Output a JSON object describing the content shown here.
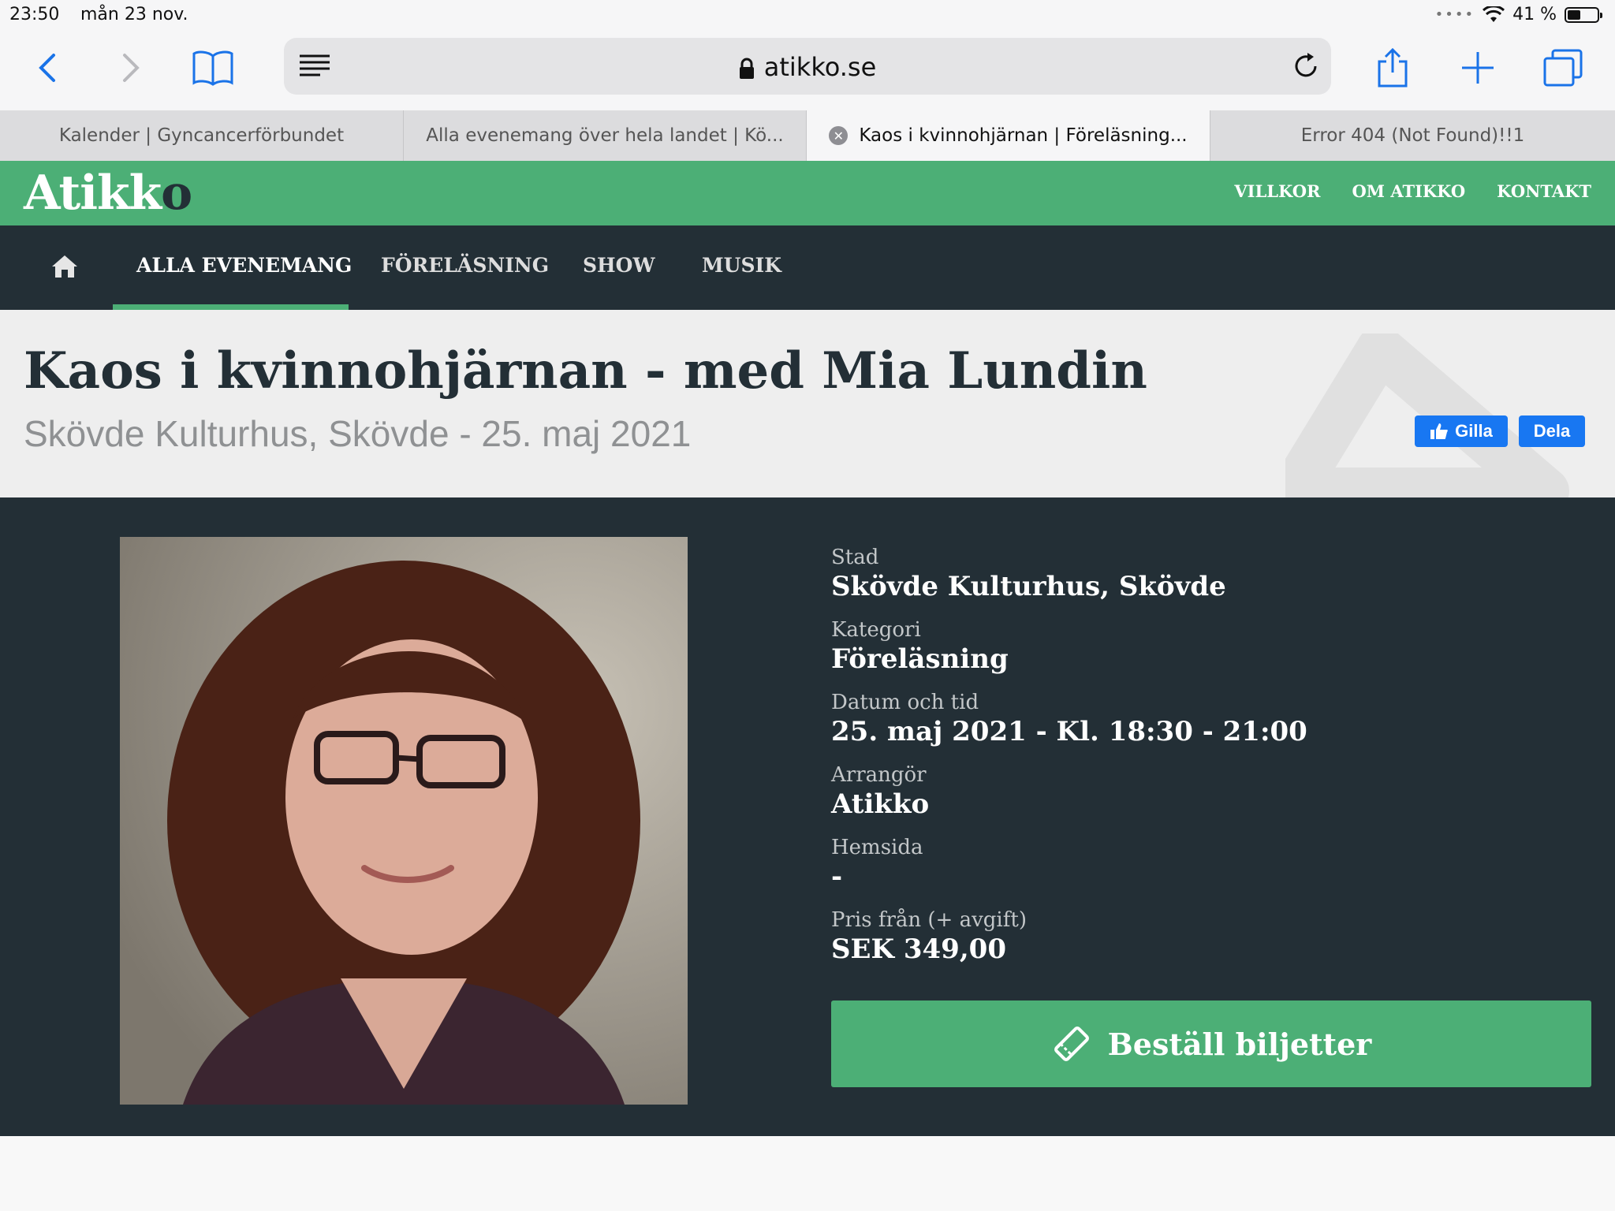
{
  "status_bar": {
    "time": "23:50",
    "date": "mån 23 nov.",
    "battery": "41 %"
  },
  "browser": {
    "url": "atikko.se",
    "tabs": [
      {
        "label": "Kalender | Gyncancerförbundet",
        "active": false
      },
      {
        "label": "Alla evenemang över hela landet | Kö...",
        "active": false
      },
      {
        "label": "Kaos i kvinnohjärnan | Föreläsning...",
        "active": true
      },
      {
        "label": "Error 404 (Not Found)!!1",
        "active": false
      }
    ]
  },
  "site": {
    "logo": "Atikk",
    "logo_last": "o",
    "top_links": [
      "VILLKOR",
      "OM ATIKKO",
      "KONTAKT"
    ],
    "nav": [
      "ALLA EVENEMANG",
      "FÖRELÄSNING",
      "SHOW",
      "MUSIK"
    ],
    "brand_color": "#4caf76",
    "dark_color": "#232f36"
  },
  "event": {
    "title": "Kaos i kvinnohjärnan - med Mia Lundin",
    "subtitle": "Skövde Kulturhus, Skövde - 25. maj 2021",
    "like_label": "Gilla",
    "share_label": "Dela",
    "fields": [
      {
        "label": "Stad",
        "value": "Skövde Kulturhus, Skövde"
      },
      {
        "label": "Kategori",
        "value": "Föreläsning"
      },
      {
        "label": "Datum och tid",
        "value": "25. maj 2021 - Kl. 18:30 - 21:00"
      },
      {
        "label": "Arrangör",
        "value": "Atikko"
      },
      {
        "label": "Hemsida",
        "value": "-"
      },
      {
        "label": "Pris från (+ avgift)",
        "value": "SEK 349,00"
      }
    ],
    "order_button": "Beställ biljetter"
  }
}
